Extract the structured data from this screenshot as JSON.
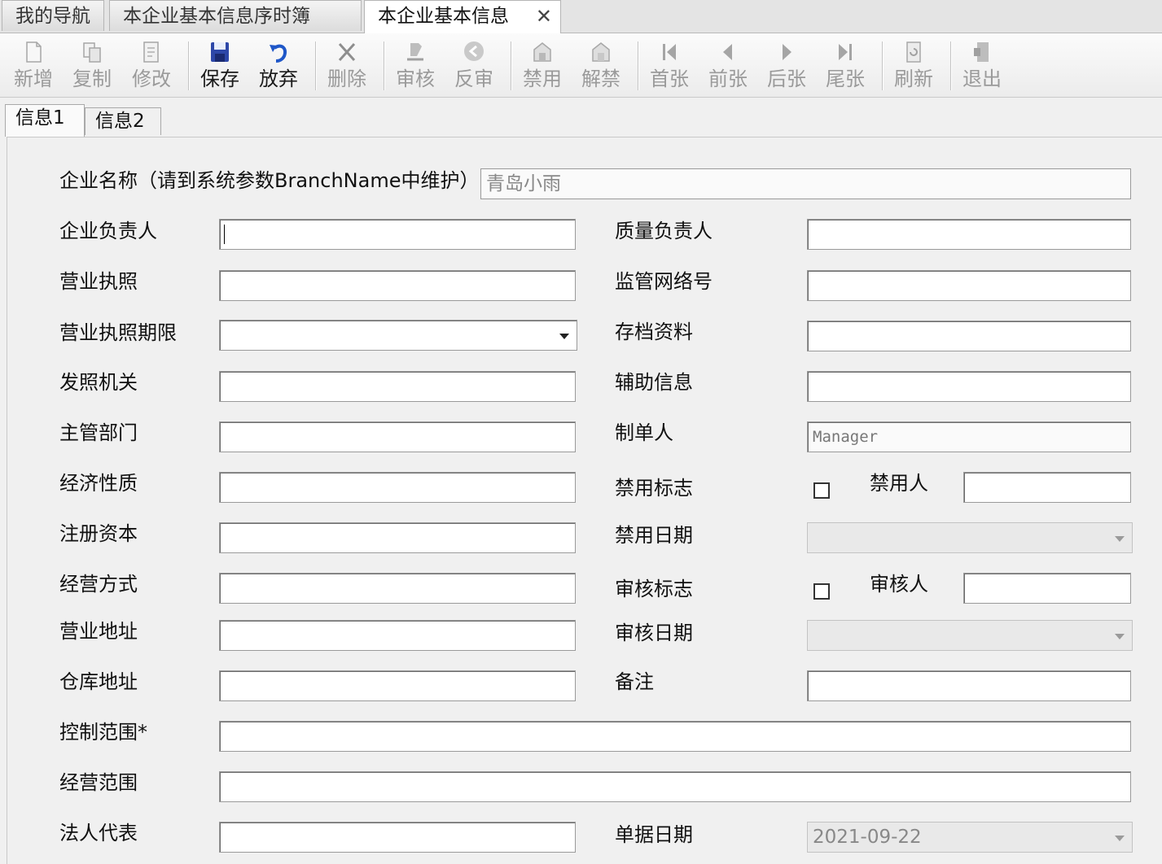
{
  "doc_tabs": [
    "我的导航",
    "本企业基本信息序时簿",
    "本企业基本信息"
  ],
  "toolbar": {
    "new": "新增",
    "copy": "复制",
    "edit": "修改",
    "save": "保存",
    "discard": "放弃",
    "delete": "删除",
    "audit": "审核",
    "unaudit": "反审",
    "disable": "禁用",
    "enable": "解禁",
    "first": "首张",
    "prev": "前张",
    "next": "后张",
    "last": "尾张",
    "refresh": "刷新",
    "exit": "退出"
  },
  "inner_tabs": [
    "信息1",
    "信息2"
  ],
  "form": {
    "company_name_label": "企业名称（请到系统参数BranchName中维护）",
    "company_name_value": "青岛小雨",
    "left_labels": [
      "企业负责人",
      "营业执照",
      "营业执照期限",
      "发照机关",
      "主管部门",
      "经济性质",
      "注册资本",
      "经营方式",
      "营业地址",
      "仓库地址",
      "控制范围*",
      "经营范围",
      "法人代表"
    ],
    "right": {
      "quality_lead": "质量负责人",
      "network_no": "监管网络号",
      "archive": "存档资料",
      "aux_info": "辅助信息",
      "creator_label": "制单人",
      "creator_value": "Manager",
      "disable_flag": "禁用标志",
      "disabled_by": "禁用人",
      "disable_date": "禁用日期",
      "audit_flag": "审核标志",
      "audited_by": "审核人",
      "audit_date": "审核日期",
      "remark": "备注",
      "doc_date_label": "单据日期",
      "doc_date_value": "2021-09-22"
    }
  }
}
